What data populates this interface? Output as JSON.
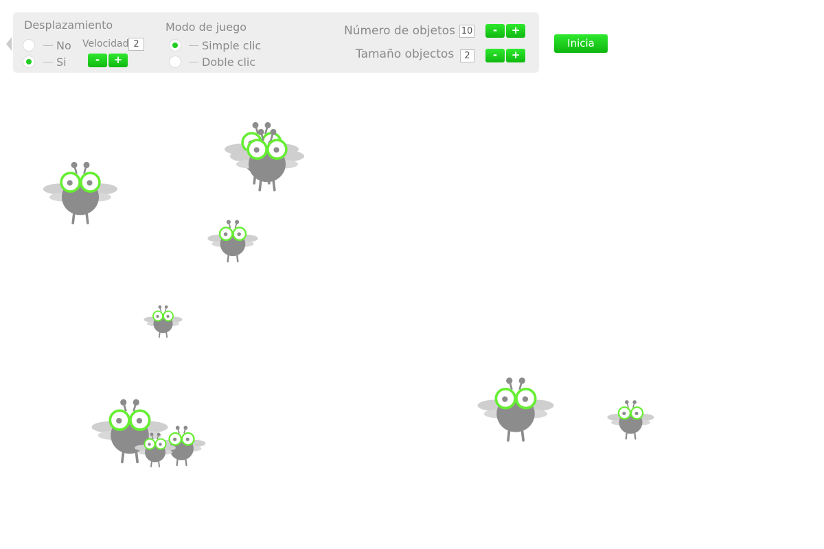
{
  "controls": {
    "movement": {
      "title": "Desplazamiento",
      "options": [
        "No",
        "Si"
      ],
      "selected": "Si",
      "speed_label": "Velocidad",
      "speed_value": "2",
      "minus_label": "-",
      "plus_label": "+"
    },
    "game_mode": {
      "title": "Modo de juego",
      "options": [
        "Simple clic",
        "Doble clic"
      ],
      "selected": "Simple clic"
    },
    "object_count": {
      "label": "Número de objetos",
      "value": "10",
      "minus_label": "-",
      "plus_label": "+"
    },
    "object_size": {
      "label": "Tamaño objectos",
      "value": "2",
      "minus_label": "-",
      "plus_label": "+"
    },
    "start_label": "Inicia"
  },
  "colors": {
    "accent_green": "#22cc22",
    "eye_ring": "#66ee33",
    "fly_body": "#8c8c8c",
    "fly_wing": "#cfcfcf",
    "panel_bg": "#eeeeee"
  },
  "flies": {
    "count_on_screen": 10,
    "icon": "fly-icon"
  }
}
